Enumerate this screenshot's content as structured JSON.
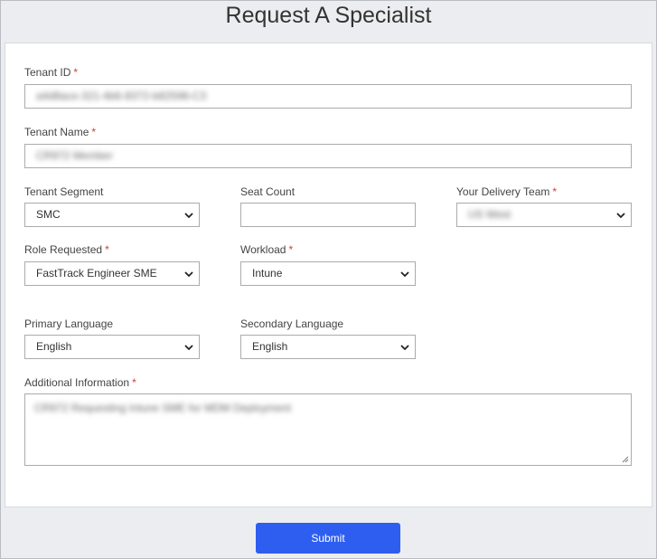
{
  "page": {
    "title": "Request A Specialist"
  },
  "form": {
    "required_mark": "*",
    "tenant_id": {
      "label": "Tenant ID",
      "value": "a4d8ace-321-4b6-8372-b82598-C3"
    },
    "tenant_name": {
      "label": "Tenant Name",
      "value": "CR972 Member"
    },
    "tenant_segment": {
      "label": "Tenant Segment",
      "value": "SMC"
    },
    "seat_count": {
      "label": "Seat Count",
      "value": ""
    },
    "delivery_team": {
      "label": "Your Delivery Team",
      "value": "US West"
    },
    "role_requested": {
      "label": "Role Requested",
      "value": "FastTrack Engineer SME"
    },
    "workload": {
      "label": "Workload",
      "value": "Intune"
    },
    "primary_language": {
      "label": "Primary Language",
      "value": "English"
    },
    "secondary_language": {
      "label": "Secondary Language",
      "value": "English"
    },
    "additional_info": {
      "label": "Additional Information",
      "value": "CR972 Requesting Intune SME for MDM Deployment"
    }
  },
  "submit": {
    "label": "Submit"
  },
  "colors": {
    "accent": "#2e5ef0",
    "required": "#d23b3b",
    "background": "#ecedf0"
  }
}
